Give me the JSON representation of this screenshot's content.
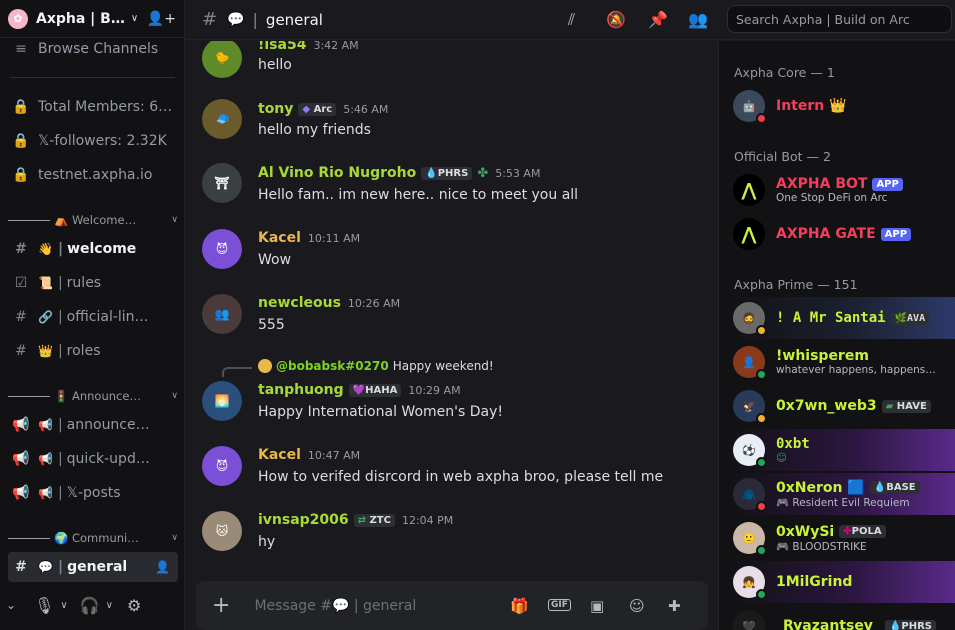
{
  "server": {
    "name": "Axpha | B…"
  },
  "sidebar": {
    "browse": "Browse Channels",
    "info": [
      {
        "label": "Total Members: 6…"
      },
      {
        "label": "𝕏-followers: 2.32K"
      },
      {
        "label": "testnet.axpha.io"
      }
    ],
    "categories": [
      {
        "label": "Welcome…",
        "emoji": "⛺"
      },
      {
        "label": "Announce…",
        "emoji": "🚦"
      },
      {
        "label": "Communi…",
        "emoji": "🌍"
      }
    ],
    "channels": [
      {
        "emoji": "👋",
        "label": "welcome"
      },
      {
        "emoji": "📜",
        "label": "rules"
      },
      {
        "emoji": "🔗",
        "label": "official-lin…"
      },
      {
        "emoji": "👑",
        "label": "roles"
      },
      {
        "emoji": "📢",
        "label": "announce…"
      },
      {
        "emoji": "📢",
        "label": "quick-upd…"
      },
      {
        "emoji": "📢",
        "label": "𝕏-posts"
      },
      {
        "emoji": "💬",
        "label": "general"
      }
    ]
  },
  "topbar": {
    "channel": "general",
    "channel_emoji": "💬",
    "search_placeholder": "Search Axpha | Build on Arc"
  },
  "messages": [
    {
      "name": "!isa54",
      "time": "3:42 AM",
      "text": "hello",
      "color": "#a8d93a",
      "tag": ""
    },
    {
      "name": "tony",
      "time": "5:46 AM",
      "text": "hello my friends",
      "color": "#a8d93a",
      "tag": "Arc"
    },
    {
      "name": "Al Vino Rio Nugroho",
      "time": "5:53 AM",
      "text": "Hello fam.. im new here.. nice to meet you all",
      "color": "#a8d93a",
      "tag": "PHRS"
    },
    {
      "name": "Kacel",
      "time": "10:11 AM",
      "text": "Wow",
      "color": "#e8b84a",
      "tag": ""
    },
    {
      "name": "newcleous",
      "time": "10:26 AM",
      "text": "555",
      "color": "#a8d93a",
      "tag": ""
    },
    {
      "name": "tanphuong",
      "time": "10:29 AM",
      "text": "Happy International Women's Day!",
      "color": "#a8d93a",
      "tag": "HAHA",
      "reply_name": "@bobabsk#0270",
      "reply_text": "Happy weekend!"
    },
    {
      "name": "Kacel",
      "time": "10:47 AM",
      "text": "How to verifed disrcord in web axpha broo, please tell me",
      "color": "#e8b84a",
      "tag": ""
    },
    {
      "name": "ivnsap2006",
      "time": "12:04 PM",
      "text": "hy",
      "color": "#a8d93a",
      "tag": "ZTC"
    }
  ],
  "composer": {
    "placeholder": "Message #💬 | general"
  },
  "members": {
    "groups": [
      "Axpha Core — 1",
      "Official Bot — 2",
      "Axpha Prime — 151"
    ],
    "list": [
      {
        "name": "Intern 👑",
        "sub": "",
        "color": "#f23f5d",
        "tag": "",
        "app": ""
      },
      {
        "name": "AXPHA BOT",
        "sub": "One Stop DeFi on Arc",
        "color": "#f23f5d",
        "tag": "",
        "app": "APP"
      },
      {
        "name": "AXPHA GATE",
        "sub": "",
        "color": "#f23f5d",
        "tag": "",
        "app": "APP"
      },
      {
        "name": "! A Mr Santai",
        "sub": "",
        "color": "#c9f23a",
        "tag": "AVA",
        "app": ""
      },
      {
        "name": "!whisperem",
        "sub": "whatever happens, happens…",
        "color": "#c9f23a",
        "tag": "",
        "app": ""
      },
      {
        "name": "0x7wn_web3",
        "sub": "",
        "color": "#c9f23a",
        "tag": "HAVE",
        "app": ""
      },
      {
        "name": "0xbt",
        "sub": "",
        "color": "#c9f23a",
        "tag": "",
        "app": ""
      },
      {
        "name": "0xNeron 🟦",
        "sub": "🎮 Resident Evil Requiem",
        "color": "#c9f23a",
        "tag": "BASE",
        "app": ""
      },
      {
        "name": "0xWySi",
        "sub": "🎮 BLOODSTRIKE",
        "color": "#c9f23a",
        "tag": "POLA",
        "app": ""
      },
      {
        "name": "1MilGrind",
        "sub": "",
        "color": "#c9f23a",
        "tag": "",
        "app": ""
      },
      {
        "name": "_Ryazantsev_",
        "sub": "",
        "color": "#c9f23a",
        "tag": "PHRS",
        "app": ""
      }
    ]
  }
}
